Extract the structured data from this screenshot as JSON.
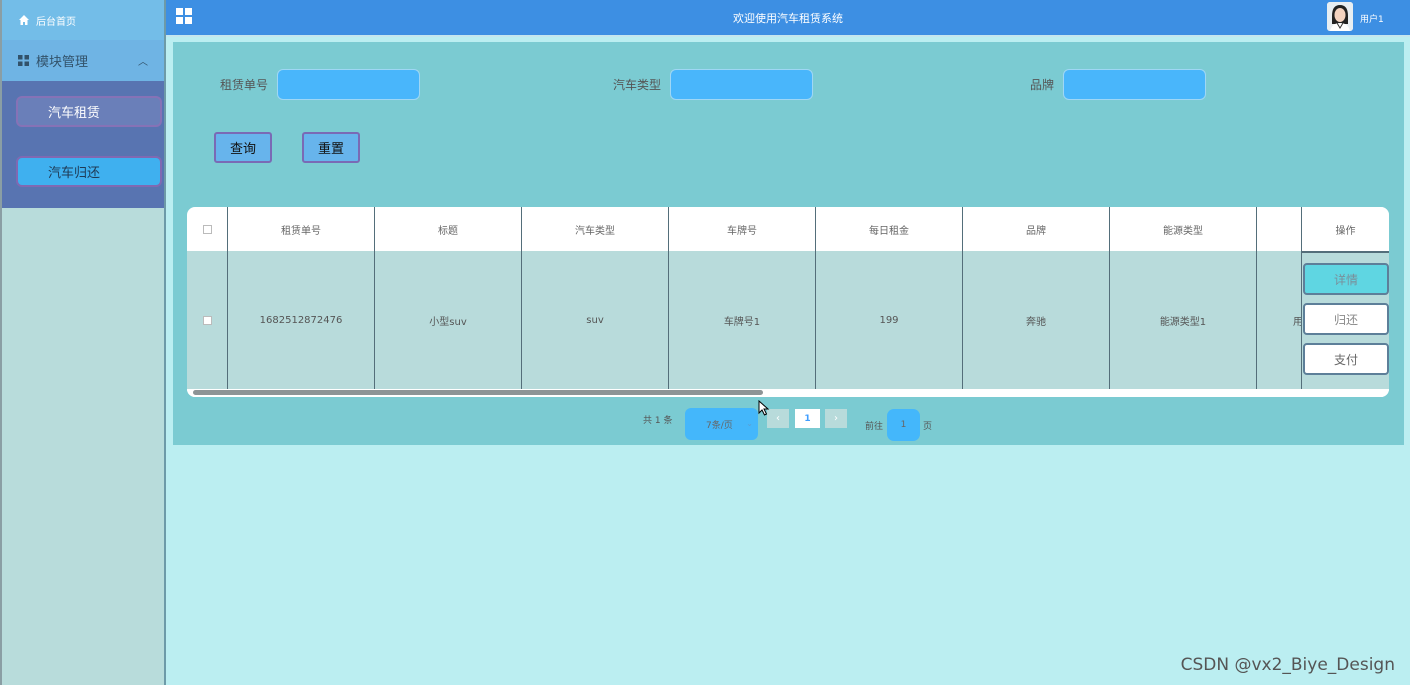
{
  "sidebar": {
    "home_label": "后台首页",
    "module_label": "模块管理",
    "items": [
      {
        "label": "汽车租赁"
      },
      {
        "label": "汽车归还"
      }
    ]
  },
  "header": {
    "title": "欢迎使用汽车租赁系统",
    "user_name": "用户1"
  },
  "search": {
    "fields": [
      {
        "label": "租赁单号",
        "value": ""
      },
      {
        "label": "汽车类型",
        "value": ""
      },
      {
        "label": "品牌",
        "value": ""
      }
    ],
    "query_label": "查询",
    "reset_label": "重置"
  },
  "table": {
    "columns": [
      "租赁单号",
      "标题",
      "汽车类型",
      "车牌号",
      "每日租金",
      "品牌",
      "能源类型",
      "",
      "操作"
    ],
    "rows": [
      {
        "cells": [
          "1682512872476",
          "小型suv",
          "suv",
          "车牌号1",
          "199",
          "奔驰",
          "能源类型1",
          "用"
        ]
      }
    ],
    "actions": {
      "detail": "详情",
      "return": "归还",
      "pay": "支付"
    }
  },
  "pagination": {
    "total": "共 1 条",
    "page_size": "7条/页",
    "current_page": "1",
    "goto_label": "前往",
    "goto_value": "1",
    "page_suffix": "页"
  },
  "watermark": "CSDN @vx2_Biye_Design",
  "colors": {
    "topbar": "#3d8fe3",
    "panel": "#7bcbd2",
    "input": "#49b6fb",
    "sidebar_sub": "#5874b1"
  }
}
